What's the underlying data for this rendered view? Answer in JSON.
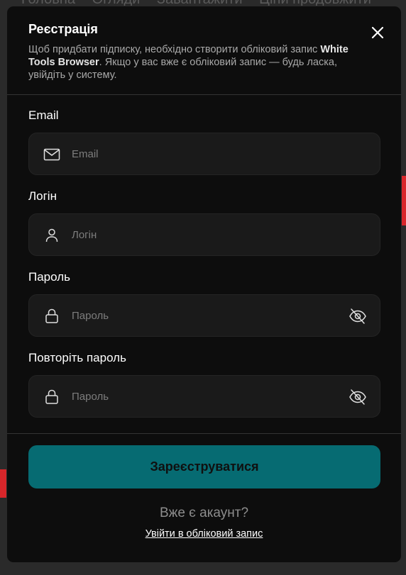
{
  "background": {
    "nav_items": [
      "Головна",
      "Огляди",
      "Завантажити",
      "Ціни продовжити"
    ],
    "colors": {
      "accent_red": "#d8262a"
    }
  },
  "modal": {
    "title": "Реєстрація",
    "description_part1": "Щоб придбати підписку, необхідно створити обліковий запис ",
    "description_brand": "White Tools Browser",
    "description_part2": ". Якщо у вас вже є обліковий запис — будь ласка, увійдіть у систему.",
    "close_icon": "close-icon"
  },
  "form": {
    "email": {
      "label": "Email",
      "placeholder": "Email",
      "icon": "envelope-icon"
    },
    "login": {
      "label": "Логін",
      "placeholder": "Логін",
      "icon": "user-icon"
    },
    "password": {
      "label": "Пароль",
      "placeholder": "Пароль",
      "icon": "lock-icon",
      "toggle_icon": "eye-off-icon"
    },
    "password_repeat": {
      "label": "Повторіть пароль",
      "placeholder": "Пароль",
      "icon": "lock-icon",
      "toggle_icon": "eye-off-icon"
    },
    "submit_label": "Зареєструватися"
  },
  "footer": {
    "have_account": "Вже є акаунт?",
    "login_link": "Увійти в обліковий запис"
  },
  "colors": {
    "modal_bg": "#0d0d0d",
    "field_bg": "#1a1a1a",
    "button_teal": "#066b72",
    "text_white": "#ffffff",
    "text_muted": "#a9a9a9"
  }
}
